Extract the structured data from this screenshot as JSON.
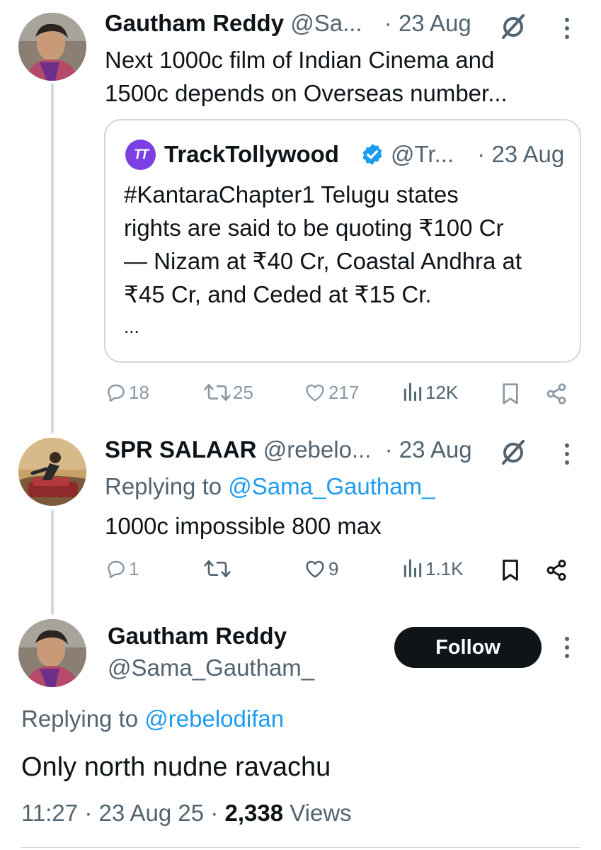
{
  "tweet1": {
    "name": "Gautham Reddy",
    "handle": "@Sa...",
    "sep": "·",
    "date": "23 Aug",
    "text_line1": "Next 1000c film of Indian Cinema and",
    "text_line2": "1500c depends on Overseas number...",
    "actions": {
      "replies": "18",
      "reposts": "25",
      "likes": "217",
      "views": "12K"
    }
  },
  "quote": {
    "logo_text": "TT",
    "name": "TrackTollywood",
    "handle": "@Tr...",
    "sep": "·",
    "date": "23 Aug",
    "lines": [
      "#KantaraChapter1 Telugu states",
      "rights are said to be quoting ₹100 Cr",
      "— Nizam at ₹40 Cr, Coastal Andhra at",
      "₹45 Cr, and Ceded at ₹15 Cr.",
      "..."
    ]
  },
  "tweet2": {
    "name": "SPR SALAAR",
    "handle": "@rebelo...",
    "sep": "·",
    "date": "23 Aug",
    "replying_label": "Replying to",
    "replying_to": "@Sama_Gautham_",
    "text": "1000c impossible 800 max",
    "actions": {
      "replies": "1",
      "likes": "9",
      "views": "1.1K"
    }
  },
  "main": {
    "name": "Gautham Reddy",
    "handle": "@Sama_Gautham_",
    "follow_label": "Follow",
    "replying_label": "Replying to",
    "replying_to": "@rebelodifan",
    "text": "Only north nudne ravachu",
    "time": "11:27",
    "sep1": "·",
    "date": "23 Aug 25",
    "sep2": "·",
    "views_count": "2,338",
    "views_label": "Views"
  },
  "colors": {
    "link": "#1d9bf0",
    "muted": "#536471",
    "border": "#cfd9de",
    "verified": "#1d9bf0",
    "logo": "#7b3fe4"
  }
}
